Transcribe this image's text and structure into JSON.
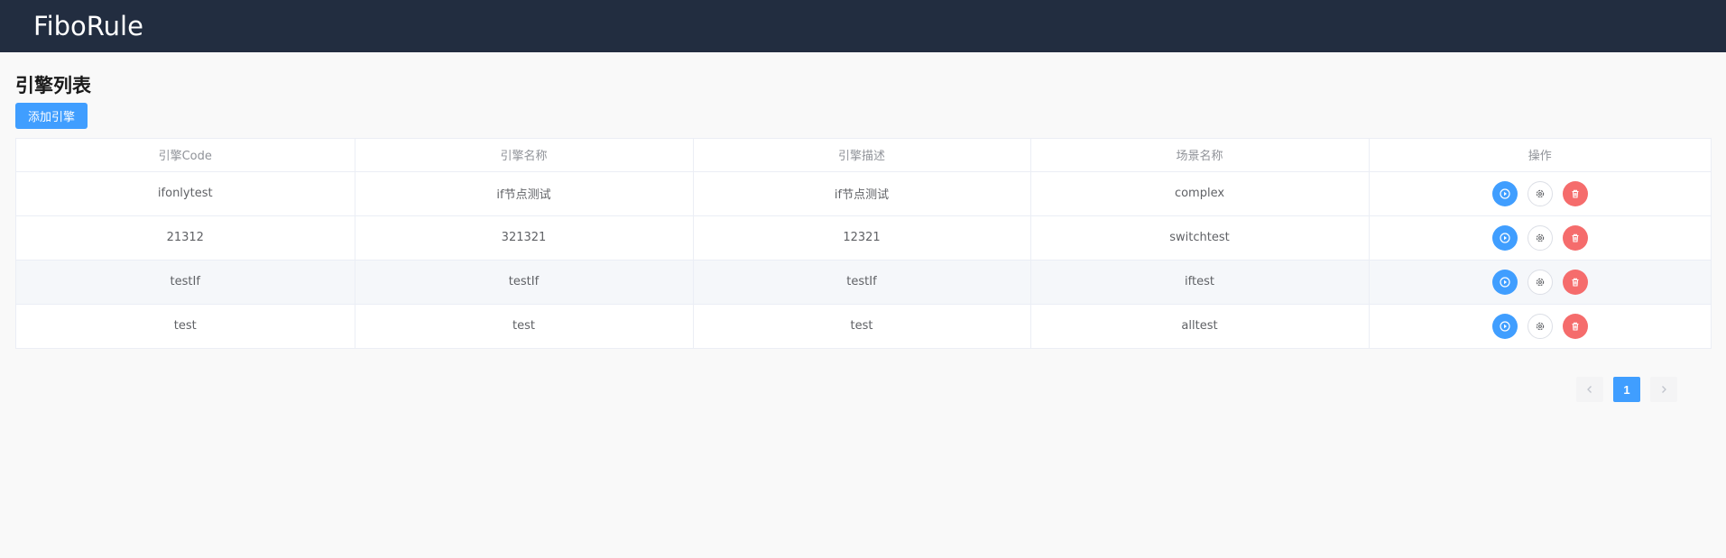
{
  "app": {
    "brand": "FiboRule"
  },
  "page": {
    "title": "引擎列表",
    "add_button_label": "添加引擎"
  },
  "table": {
    "columns": [
      "引擎Code",
      "引擎名称",
      "引擎描述",
      "场景名称",
      "操作"
    ],
    "rows": [
      {
        "code": "ifonlytest",
        "name": "if节点测试",
        "description": "if节点测试",
        "scene": "complex"
      },
      {
        "code": "21312",
        "name": "321321",
        "description": "12321",
        "scene": "switchtest"
      },
      {
        "code": "testIf",
        "name": "testIf",
        "description": "testIf",
        "scene": "iftest"
      },
      {
        "code": "test",
        "name": "test",
        "description": "test",
        "scene": "alltest"
      }
    ],
    "row_actions": [
      "play-icon",
      "gear-icon",
      "trash-icon"
    ]
  },
  "pagination": {
    "current_page": "1",
    "prev_icon": "chevron-left-icon",
    "next_icon": "chevron-right-icon"
  },
  "colors": {
    "header_bg": "#222d40",
    "primary": "#409eff",
    "danger": "#f56c6c"
  }
}
